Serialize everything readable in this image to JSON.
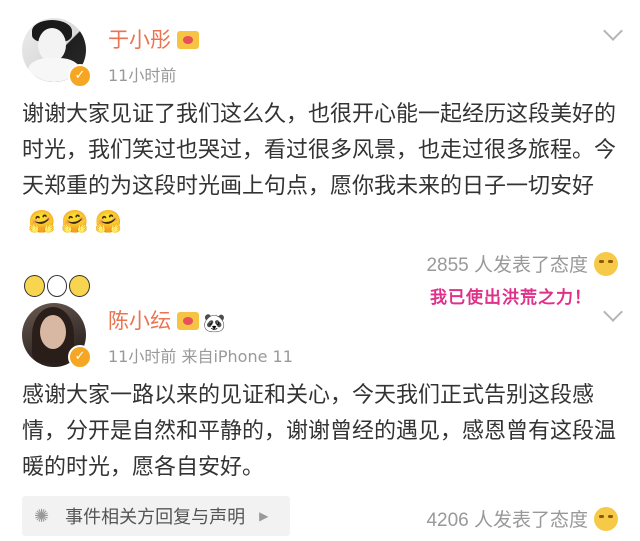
{
  "post1": {
    "author": "于小彤",
    "time": "11小时前",
    "text": "谢谢大家见证了我们这么久，也很开心能一起经历这段美好的时光，我们笑过也哭过，看过很多风景，也走过很多旅程。今天郑重的为这段时光画上句点，愿你我未来的日子一切安好",
    "emojis": [
      "🤗",
      "🤗",
      "🤗"
    ],
    "reactions": "2855 人发表了态度",
    "badge_icon": "verified-icon"
  },
  "post2": {
    "author": "陈小纭",
    "time": "11小时前   来自iPhone 11",
    "sticker": "我已使出洪荒之力！",
    "text": "感谢大家一路以来的见证和关心，今天我们正式告别这段感情，分开是自然和平静的，谢谢曾经的遇见，感恩曾有这段温暖的时光，愿各自安好。",
    "tag": "事件相关方回复与声明",
    "reactions": "4206 人发表了态度",
    "badge_icon": "verified-icon"
  },
  "colors": {
    "name": "#eb7350",
    "meta": "#999999",
    "text": "#333333",
    "badge": "#f5a623"
  }
}
